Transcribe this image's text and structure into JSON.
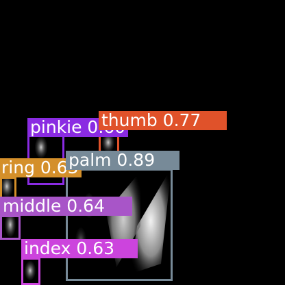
{
  "detections": [
    {
      "id": "pinkie",
      "label": "pinkie 0.60",
      "class": "pinkie",
      "confidence": 0.6,
      "color": "#8a2be2"
    },
    {
      "id": "thumb",
      "label": "thumb 0.77",
      "class": "thumb",
      "confidence": 0.77,
      "color": "#e0522a"
    },
    {
      "id": "palm",
      "label": "palm 0.89",
      "class": "palm",
      "confidence": 0.89,
      "color": "#778a98"
    },
    {
      "id": "ring",
      "label": "ring 0.63",
      "class": "ring",
      "confidence": 0.63,
      "color": "#d48f2a"
    },
    {
      "id": "middle",
      "label": "middle 0.64",
      "class": "middle",
      "confidence": 0.64,
      "color": "#a855c8"
    },
    {
      "id": "index",
      "label": "index 0.63",
      "class": "index",
      "confidence": 0.63,
      "color": "#cc44dd"
    }
  ]
}
